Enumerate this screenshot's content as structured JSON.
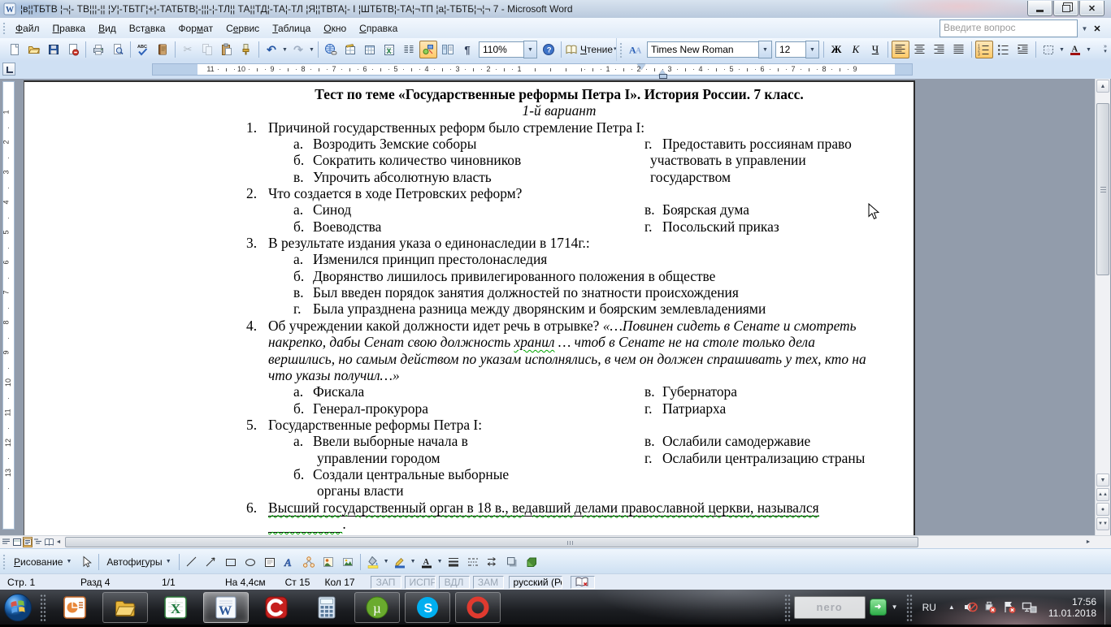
{
  "window": {
    "title": "¦в¦¦ТБТВ ¦¬¦- ТВ¦¦¦-¦¦  ¦У¦-ТБТГ¦+¦-ТАТБТВ¦-¦¦¦-¦-ТЛ¦¦ ТА¦¦ТД¦-ТА¦-ТЛ ¦Я¦¦ТВТА¦- I  ¦ШТБТВ¦-ТА¦¬ТП ¦а¦-ТБТБ¦¬¦¬ 7 - Microsoft Word"
  },
  "menu": {
    "items": [
      {
        "label": "Файл",
        "u": 0
      },
      {
        "label": "Правка",
        "u": 0
      },
      {
        "label": "Вид",
        "u": 0
      },
      {
        "label": "Вставка",
        "u": 3
      },
      {
        "label": "Формат",
        "u": 3
      },
      {
        "label": "Сервис",
        "u": 1
      },
      {
        "label": "Таблица",
        "u": 0
      },
      {
        "label": "Окно",
        "u": 0
      },
      {
        "label": "Справка",
        "u": 0
      }
    ],
    "question_placeholder": "Введите вопрос"
  },
  "toolbars": {
    "standard": [
      {
        "i": "new-document"
      },
      {
        "i": "open-folder"
      },
      {
        "i": "save"
      },
      {
        "i": "permission"
      },
      {
        "sep": 1
      },
      {
        "i": "print"
      },
      {
        "i": "print-preview"
      },
      {
        "sep": 1
      },
      {
        "i": "spelling"
      },
      {
        "i": "research"
      },
      {
        "sep": 1
      },
      {
        "i": "cut",
        "dis": 1
      },
      {
        "i": "copy",
        "dis": 1
      },
      {
        "i": "paste"
      },
      {
        "i": "format-painter"
      },
      {
        "sep": 1
      },
      {
        "i": "undo",
        "dd": 1
      },
      {
        "i": "redo",
        "dis": 1,
        "dd": 1
      },
      {
        "sep": 1
      },
      {
        "i": "hyperlink"
      },
      {
        "i": "tables-borders"
      },
      {
        "i": "insert-table"
      },
      {
        "i": "insert-excel"
      },
      {
        "i": "columns"
      },
      {
        "i": "drawing",
        "act": 1
      },
      {
        "i": "document-map"
      },
      {
        "i": "show-marks"
      },
      {
        "combo": "zoom"
      },
      {
        "i": "help"
      },
      {
        "sep": 1
      },
      {
        "i": "read-mode",
        "withlabel": 1
      }
    ],
    "formatting": [
      {
        "i": "styles"
      },
      {
        "combo": "font"
      },
      {
        "combo": "size"
      },
      {
        "sep": 1
      },
      {
        "i": "bold"
      },
      {
        "i": "italic"
      },
      {
        "i": "underline"
      },
      {
        "sep": 1
      },
      {
        "i": "align-left",
        "act": 1
      },
      {
        "i": "align-center"
      },
      {
        "i": "align-right"
      },
      {
        "i": "align-justify"
      },
      {
        "sep": 1
      },
      {
        "i": "numbered-list",
        "act": 1
      },
      {
        "i": "bullet-list"
      },
      {
        "i": "increase-indent"
      },
      {
        "sep": 1
      },
      {
        "i": "borders",
        "dd": 1
      },
      {
        "i": "font-color",
        "dd": 1
      }
    ],
    "zoom_value": "110%",
    "read_label": "Чтение",
    "font_value": "Times New Roman",
    "size_value": "12",
    "bold_label": "Ж",
    "italic_label": "К",
    "underline_label": "Ч"
  },
  "ruler": {
    "h_desc": [
      "11",
      "10",
      "9",
      "8",
      "7",
      "6",
      "5",
      "4",
      "3",
      "2",
      "1"
    ],
    "h_asc": [
      "1",
      "2",
      "3",
      "4",
      "5",
      "6",
      "7",
      "8",
      "9"
    ],
    "v": [
      "1",
      "2",
      "3",
      "4",
      "5",
      "6",
      "7",
      "8",
      "9",
      "10",
      "11",
      "12",
      "13"
    ]
  },
  "document": {
    "lines": [
      {
        "type": "center",
        "segs": [
          {
            "t": "Тест по теме «Государственные реформы Петра I». История России. 7 класс.",
            "b": 1
          }
        ]
      },
      {
        "type": "center",
        "segs": [
          {
            "t": "1-й вариант",
            "i": 1
          }
        ]
      },
      {
        "type": "item",
        "num": "1.",
        "segs": [
          {
            "t": "Причиной государственных реформ было стремление Петра I:"
          }
        ]
      },
      {
        "type": "two",
        "l": {
          "letter": "а.",
          "t": "Возродить Земские соборы"
        },
        "r": {
          "letter": "г.",
          "t": "Предоставить россиянам право"
        }
      },
      {
        "type": "two",
        "l": {
          "letter": "б.",
          "t": "Сократить количество чиновников"
        },
        "r": {
          "letter": "",
          "t": "участвовать в управлении"
        }
      },
      {
        "type": "two",
        "l": {
          "letter": "в.",
          "t": "Упрочить абсолютную власть"
        },
        "r": {
          "letter": "",
          "t": "государством"
        }
      },
      {
        "type": "item",
        "num": "2.",
        "segs": [
          {
            "t": "Что создается в ходе Петровских реформ?"
          }
        ]
      },
      {
        "type": "two",
        "l": {
          "letter": "а.",
          "t": "Синод"
        },
        "r": {
          "letter": "в.",
          "t": "Боярская дума"
        }
      },
      {
        "type": "two",
        "l": {
          "letter": "б.",
          "t": "Воеводства"
        },
        "r": {
          "letter": "г.",
          "t": "Посольский приказ"
        }
      },
      {
        "type": "item",
        "num": "3.",
        "segs": [
          {
            "t": "В результате издания указа о единонаследии в 1714г.:"
          }
        ]
      },
      {
        "type": "opt",
        "letter": "а.",
        "segs": [
          {
            "t": "Изменился принцип престолонаследия"
          }
        ]
      },
      {
        "type": "opt",
        "letter": "б.",
        "segs": [
          {
            "t": "Дворянство лишилось привилегированного положения в обществе"
          }
        ]
      },
      {
        "type": "opt",
        "letter": "в.",
        "segs": [
          {
            "t": "Был введен порядок занятия должностей по знатности происхождения"
          }
        ]
      },
      {
        "type": "opt",
        "letter": "г.",
        "segs": [
          {
            "t": "Была упразднена разница между дворянским и боярским землевладениями"
          }
        ]
      },
      {
        "type": "item",
        "num": "4.",
        "segs": [
          {
            "t": "Об учреждении какой должности идет речь в отрывке? "
          },
          {
            "t": "«…Повинен сидеть в Сенате и смотреть",
            "i": 1
          }
        ]
      },
      {
        "type": "cont",
        "segs": [
          {
            "t": "накрепко, дабы Сенат свою должность ",
            "i": 1
          },
          {
            "t": "хранил",
            "i": 1,
            "sq": 1
          },
          {
            "t": " … чтоб в Сенате не на столе только дела",
            "i": 1
          }
        ]
      },
      {
        "type": "cont",
        "segs": [
          {
            "t": "вершились, но самым действом по указам исполнялись, в чем он должен спрашивать у тех, кто на",
            "i": 1
          }
        ]
      },
      {
        "type": "cont",
        "segs": [
          {
            "t": "что указы получил…»",
            "i": 1
          }
        ]
      },
      {
        "type": "two",
        "l": {
          "letter": "а.",
          "t": "Фискала"
        },
        "r": {
          "letter": "в.",
          "t": "Губернатора"
        }
      },
      {
        "type": "two",
        "l": {
          "letter": "б.",
          "t": "Генерал-прокурора"
        },
        "r": {
          "letter": "г.",
          "t": "Патриарха"
        }
      },
      {
        "type": "item",
        "num": "5.",
        "segs": [
          {
            "t": "Государственные реформы Петра I:"
          }
        ]
      },
      {
        "type": "two",
        "l": {
          "letter": "а.",
          "t": "Ввели выборные начала в"
        },
        "r": {
          "letter": "в.",
          "t": "Ослабили самодержавие"
        }
      },
      {
        "type": "two",
        "l": {
          "letter": "",
          "t": "управлении городом"
        },
        "r": {
          "letter": "г.",
          "t": "Ослабили централизацию страны"
        }
      },
      {
        "type": "two",
        "l": {
          "letter": "б.",
          "t": "Создали центральные выборные"
        },
        "r": null
      },
      {
        "type": "two",
        "l": {
          "letter": "",
          "t": "органы власти"
        },
        "r": null
      },
      {
        "type": "item",
        "num": "6.",
        "segs": [
          {
            "t": "Высший государственный орган в 18 в., ведавший делами православной церкви, назывался ",
            "u": 1,
            "sq": 1
          }
        ]
      },
      {
        "type": "cont",
        "segs": [
          {
            "blank": 21,
            "u": 1,
            "sq": 1
          },
          {
            "t": "."
          }
        ]
      }
    ]
  },
  "drawing_bar": {
    "draw_label": {
      "label": "Рисование",
      "u": 0
    },
    "autoshapes_label": {
      "label": "Автофигуры",
      "u": 6
    },
    "items": [
      "select-arrow",
      "sep",
      "line-shape",
      "arrow-shape",
      "rect-shape",
      "oval-shape",
      "text-box",
      "wordart",
      "diagram",
      "clip-art",
      "picture",
      "sep",
      "fill-color",
      "line-color",
      "font-color-2",
      "line-style",
      "dash-style",
      "arrow-style",
      "shadow-style",
      "threed-style"
    ]
  },
  "status_bar": {
    "page": "Стр. 1",
    "section": "Разд 4",
    "pages": "1/1",
    "position": "На 4,4см",
    "line": "Ст 15",
    "column": "Кол 17",
    "modes": [
      "ЗАП",
      "ИСПР",
      "ВДЛ",
      "ЗАМ"
    ],
    "language": "русский (Ро"
  },
  "taskbar": {
    "apps": [
      {
        "icon": "powerpoint",
        "frame": 0
      },
      {
        "icon": "explorer",
        "frame": 1
      },
      {
        "icon": "excel",
        "frame": 0
      },
      {
        "icon": "word",
        "frame": 1,
        "active": 1
      },
      {
        "icon": "red-c-app",
        "frame": 0
      },
      {
        "icon": "calculator",
        "frame": 0
      },
      {
        "icon": "utorrent",
        "frame": 1
      },
      {
        "icon": "skype",
        "frame": 1
      },
      {
        "icon": "opera",
        "frame": 1
      }
    ],
    "tray": {
      "search_text": "nero",
      "language": "RU",
      "time": "17:56",
      "date": "11.01.2018"
    }
  }
}
